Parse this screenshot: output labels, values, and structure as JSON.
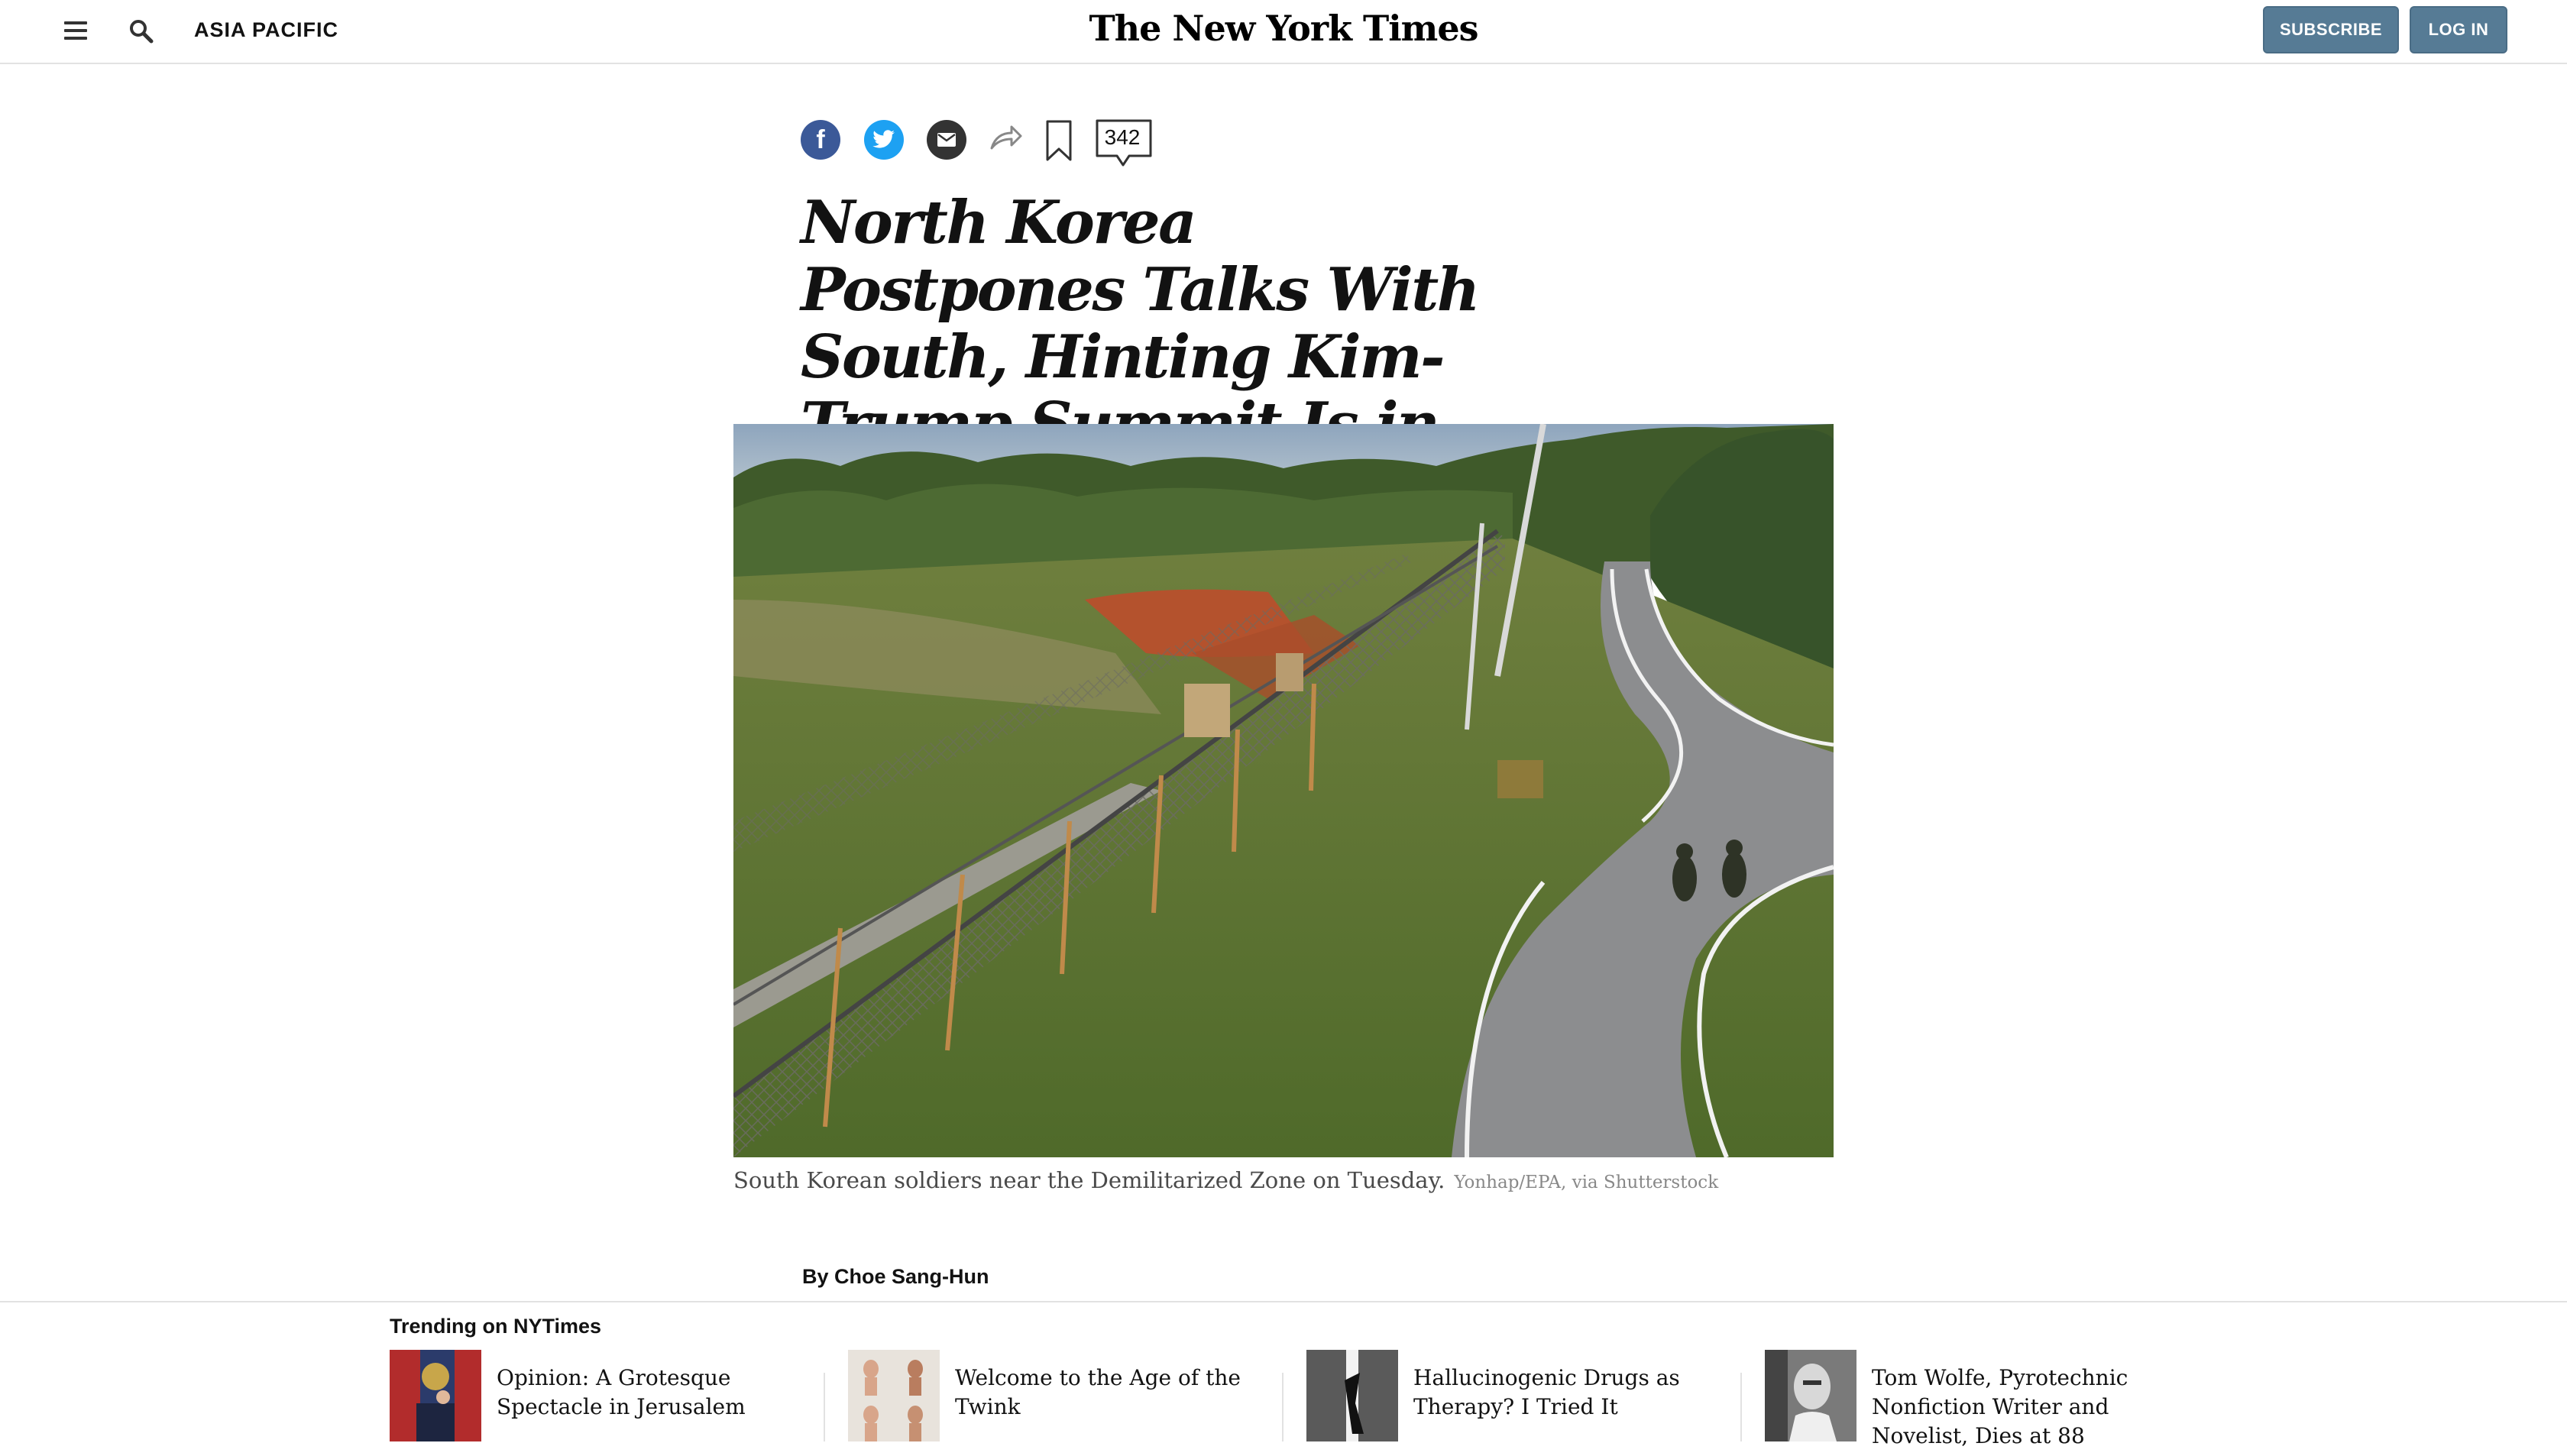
{
  "header": {
    "section": "ASIA PACIFIC",
    "logo": "The New York Times",
    "subscribe_label": "SUBSCRIBE",
    "login_label": "LOG IN",
    "accent_color": "#567b95"
  },
  "share": {
    "icons": [
      "facebook-icon",
      "twitter-icon",
      "email-icon",
      "share-icon",
      "bookmark-icon",
      "comments-icon"
    ],
    "comment_count": "342"
  },
  "article": {
    "headline": "North Korea Postpones Talks With South, Hinting Kim-Trump Summit Is in Peril",
    "caption": "South Korean soldiers near the Demilitarized Zone on Tuesday.",
    "credit": "Yonhap/EPA, via Shutterstock",
    "byline": "By Choe Sang-Hun"
  },
  "trending": {
    "title": "Trending on NYTimes",
    "items": [
      {
        "text": "Opinion: A Grotesque Spectacle in Jerusalem"
      },
      {
        "text": "Welcome to the Age of the Twink"
      },
      {
        "text": "Hallucinogenic Drugs as Therapy? I Tried It"
      },
      {
        "text": "Tom Wolfe, Pyrotechnic Nonfiction Writer and Novelist, Dies at 88"
      }
    ]
  }
}
